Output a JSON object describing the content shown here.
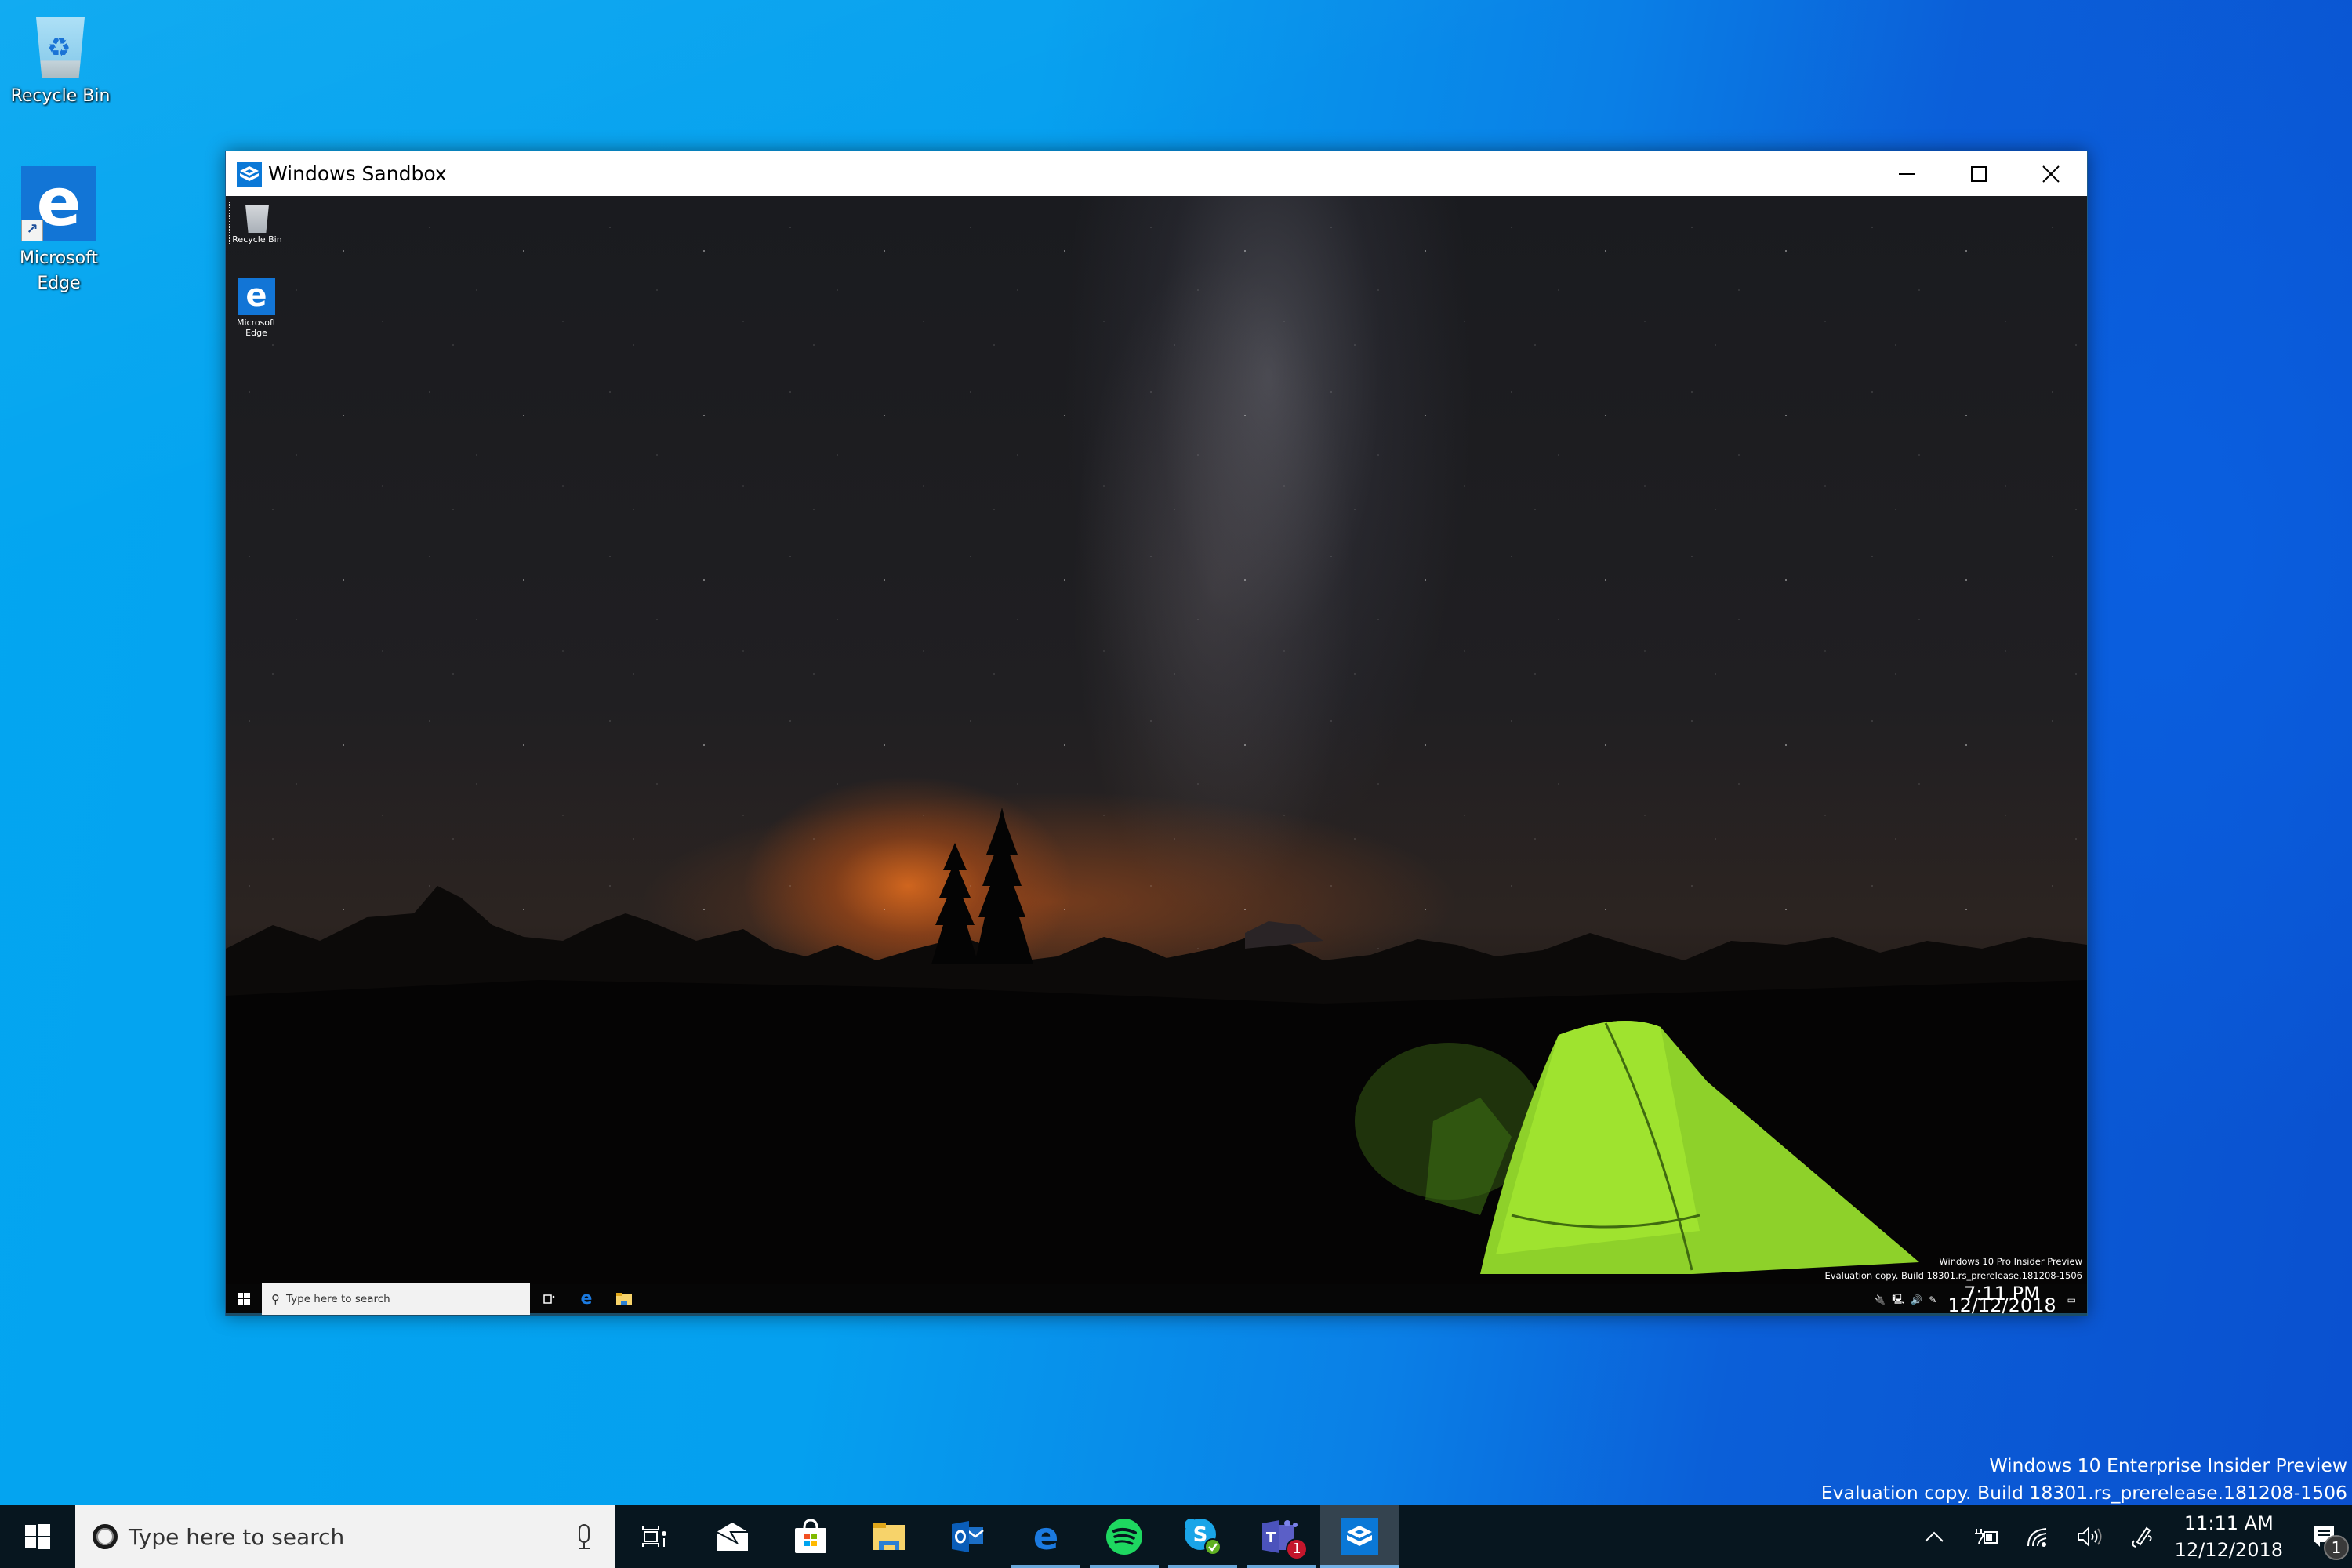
{
  "desktop": {
    "icons": [
      {
        "label": "Recycle Bin",
        "icon": "recycle-bin-icon"
      },
      {
        "label": "Microsoft\nEdge",
        "line1": "Microsoft",
        "line2": "Edge",
        "icon": "edge-icon"
      }
    ],
    "watermark": {
      "line1": "Windows 10 Enterprise Insider Preview",
      "line2": "Evaluation copy. Build 18301.rs_prerelease.181208-1506"
    }
  },
  "window": {
    "title": "Windows Sandbox",
    "icon": "sandbox-icon",
    "controls": {
      "minimize": "minimize-icon",
      "maximize": "maximize-icon",
      "close": "close-icon"
    }
  },
  "sandbox": {
    "icons": [
      {
        "label": "Recycle Bin",
        "icon": "recycle-bin-icon"
      },
      {
        "line1": "Microsoft",
        "line2": "Edge",
        "icon": "edge-icon"
      }
    ],
    "watermark": {
      "line1": "Windows 10 Pro Insider Preview",
      "line2": "Evaluation copy. Build 18301.rs_prerelease.181208-1506"
    },
    "taskbar": {
      "search_placeholder": "Type here to search",
      "apps": [
        "task-view-icon",
        "edge-icon",
        "file-explorer-icon"
      ],
      "tray": [
        "power-icon",
        "network-icon",
        "volume-icon",
        "pen-icon"
      ],
      "time": "7:11 PM",
      "date": "12/12/2018"
    }
  },
  "taskbar": {
    "search_placeholder": "Type here to search",
    "apps": [
      {
        "name": "Task View",
        "icon": "task-view-icon",
        "running": false
      },
      {
        "name": "Mail",
        "icon": "mail-icon",
        "running": false
      },
      {
        "name": "Microsoft Store",
        "icon": "store-icon",
        "running": false
      },
      {
        "name": "File Explorer",
        "icon": "file-explorer-icon",
        "running": false
      },
      {
        "name": "Outlook",
        "icon": "outlook-icon",
        "running": false
      },
      {
        "name": "Microsoft Edge",
        "icon": "edge-icon",
        "running": true
      },
      {
        "name": "Spotify",
        "icon": "spotify-icon",
        "running": true
      },
      {
        "name": "Skype",
        "icon": "skype-icon",
        "running": true
      },
      {
        "name": "Microsoft Teams",
        "icon": "teams-icon",
        "running": true,
        "badge": "1"
      },
      {
        "name": "Windows Sandbox",
        "icon": "sandbox-icon",
        "running": true,
        "active": true
      }
    ],
    "tray": {
      "icons": [
        "show-hidden-icons-chevron",
        "power-icon",
        "wifi-icon",
        "volume-icon",
        "pen-icon"
      ],
      "time": "11:11 AM",
      "date": "12/12/2018",
      "notification_count": "1"
    }
  },
  "colors": {
    "accent": "#0a78d7",
    "taskbar_bg": "#07161f",
    "desktop_blue": "#05a0ef"
  }
}
